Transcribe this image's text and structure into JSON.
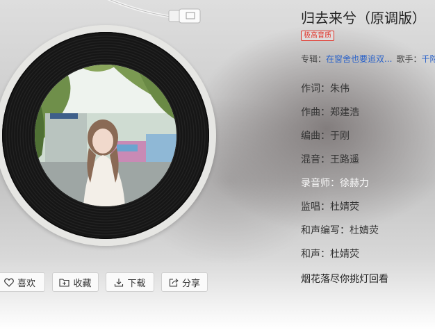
{
  "song": {
    "title": "归去来兮（原调版）",
    "quality_badge": "极高音质",
    "album_label": "专辑：",
    "album_name": "在窗舍也要追双...",
    "singer_label": "歌手：",
    "singer_name": "千陀"
  },
  "credits": [
    {
      "label": "作词",
      "value": "朱伟"
    },
    {
      "label": "作曲",
      "value": "郑建浩"
    },
    {
      "label": "编曲",
      "value": "于刚"
    },
    {
      "label": "混音",
      "value": "王路遥"
    },
    {
      "label": "录音师",
      "value": "徐赫力"
    },
    {
      "label": "监唱",
      "value": "杜婧荧"
    },
    {
      "label": "和声编写",
      "value": "杜婧荧"
    },
    {
      "label": "和声",
      "value": "杜婧荧"
    }
  ],
  "lyric_line": "烟花落尽你挑灯回看",
  "actions": {
    "like_label": "喜欢",
    "collect_label": "收藏",
    "download_label": "下载",
    "share_label": "分享"
  },
  "colors": {
    "accent_link": "#2a62c9",
    "quality_badge": "#e0352b"
  }
}
